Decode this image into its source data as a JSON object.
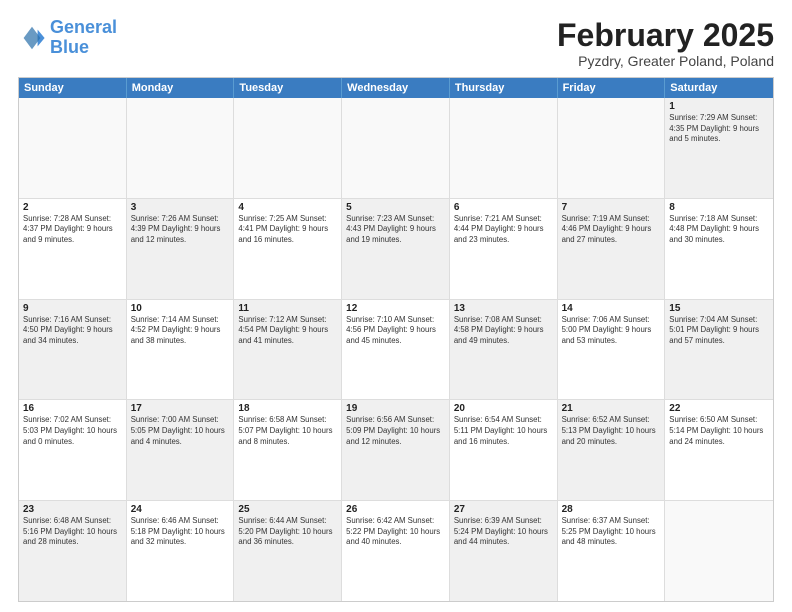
{
  "header": {
    "logo_line1": "General",
    "logo_line2": "Blue",
    "title": "February 2025",
    "subtitle": "Pyzdry, Greater Poland, Poland"
  },
  "day_headers": [
    "Sunday",
    "Monday",
    "Tuesday",
    "Wednesday",
    "Thursday",
    "Friday",
    "Saturday"
  ],
  "weeks": [
    [
      {
        "num": "",
        "info": "",
        "empty": true
      },
      {
        "num": "",
        "info": "",
        "empty": true
      },
      {
        "num": "",
        "info": "",
        "empty": true
      },
      {
        "num": "",
        "info": "",
        "empty": true
      },
      {
        "num": "",
        "info": "",
        "empty": true
      },
      {
        "num": "",
        "info": "",
        "empty": true
      },
      {
        "num": "1",
        "info": "Sunrise: 7:29 AM\nSunset: 4:35 PM\nDaylight: 9 hours\nand 5 minutes.",
        "shaded": true
      }
    ],
    [
      {
        "num": "2",
        "info": "Sunrise: 7:28 AM\nSunset: 4:37 PM\nDaylight: 9 hours\nand 9 minutes."
      },
      {
        "num": "3",
        "info": "Sunrise: 7:26 AM\nSunset: 4:39 PM\nDaylight: 9 hours\nand 12 minutes.",
        "shaded": true
      },
      {
        "num": "4",
        "info": "Sunrise: 7:25 AM\nSunset: 4:41 PM\nDaylight: 9 hours\nand 16 minutes."
      },
      {
        "num": "5",
        "info": "Sunrise: 7:23 AM\nSunset: 4:43 PM\nDaylight: 9 hours\nand 19 minutes.",
        "shaded": true
      },
      {
        "num": "6",
        "info": "Sunrise: 7:21 AM\nSunset: 4:44 PM\nDaylight: 9 hours\nand 23 minutes."
      },
      {
        "num": "7",
        "info": "Sunrise: 7:19 AM\nSunset: 4:46 PM\nDaylight: 9 hours\nand 27 minutes.",
        "shaded": true
      },
      {
        "num": "8",
        "info": "Sunrise: 7:18 AM\nSunset: 4:48 PM\nDaylight: 9 hours\nand 30 minutes."
      }
    ],
    [
      {
        "num": "9",
        "info": "Sunrise: 7:16 AM\nSunset: 4:50 PM\nDaylight: 9 hours\nand 34 minutes.",
        "shaded": true
      },
      {
        "num": "10",
        "info": "Sunrise: 7:14 AM\nSunset: 4:52 PM\nDaylight: 9 hours\nand 38 minutes."
      },
      {
        "num": "11",
        "info": "Sunrise: 7:12 AM\nSunset: 4:54 PM\nDaylight: 9 hours\nand 41 minutes.",
        "shaded": true
      },
      {
        "num": "12",
        "info": "Sunrise: 7:10 AM\nSunset: 4:56 PM\nDaylight: 9 hours\nand 45 minutes."
      },
      {
        "num": "13",
        "info": "Sunrise: 7:08 AM\nSunset: 4:58 PM\nDaylight: 9 hours\nand 49 minutes.",
        "shaded": true
      },
      {
        "num": "14",
        "info": "Sunrise: 7:06 AM\nSunset: 5:00 PM\nDaylight: 9 hours\nand 53 minutes."
      },
      {
        "num": "15",
        "info": "Sunrise: 7:04 AM\nSunset: 5:01 PM\nDaylight: 9 hours\nand 57 minutes.",
        "shaded": true
      }
    ],
    [
      {
        "num": "16",
        "info": "Sunrise: 7:02 AM\nSunset: 5:03 PM\nDaylight: 10 hours\nand 0 minutes."
      },
      {
        "num": "17",
        "info": "Sunrise: 7:00 AM\nSunset: 5:05 PM\nDaylight: 10 hours\nand 4 minutes.",
        "shaded": true
      },
      {
        "num": "18",
        "info": "Sunrise: 6:58 AM\nSunset: 5:07 PM\nDaylight: 10 hours\nand 8 minutes."
      },
      {
        "num": "19",
        "info": "Sunrise: 6:56 AM\nSunset: 5:09 PM\nDaylight: 10 hours\nand 12 minutes.",
        "shaded": true
      },
      {
        "num": "20",
        "info": "Sunrise: 6:54 AM\nSunset: 5:11 PM\nDaylight: 10 hours\nand 16 minutes."
      },
      {
        "num": "21",
        "info": "Sunrise: 6:52 AM\nSunset: 5:13 PM\nDaylight: 10 hours\nand 20 minutes.",
        "shaded": true
      },
      {
        "num": "22",
        "info": "Sunrise: 6:50 AM\nSunset: 5:14 PM\nDaylight: 10 hours\nand 24 minutes."
      }
    ],
    [
      {
        "num": "23",
        "info": "Sunrise: 6:48 AM\nSunset: 5:16 PM\nDaylight: 10 hours\nand 28 minutes.",
        "shaded": true
      },
      {
        "num": "24",
        "info": "Sunrise: 6:46 AM\nSunset: 5:18 PM\nDaylight: 10 hours\nand 32 minutes."
      },
      {
        "num": "25",
        "info": "Sunrise: 6:44 AM\nSunset: 5:20 PM\nDaylight: 10 hours\nand 36 minutes.",
        "shaded": true
      },
      {
        "num": "26",
        "info": "Sunrise: 6:42 AM\nSunset: 5:22 PM\nDaylight: 10 hours\nand 40 minutes."
      },
      {
        "num": "27",
        "info": "Sunrise: 6:39 AM\nSunset: 5:24 PM\nDaylight: 10 hours\nand 44 minutes.",
        "shaded": true
      },
      {
        "num": "28",
        "info": "Sunrise: 6:37 AM\nSunset: 5:25 PM\nDaylight: 10 hours\nand 48 minutes."
      },
      {
        "num": "",
        "info": "",
        "empty": true
      }
    ]
  ]
}
